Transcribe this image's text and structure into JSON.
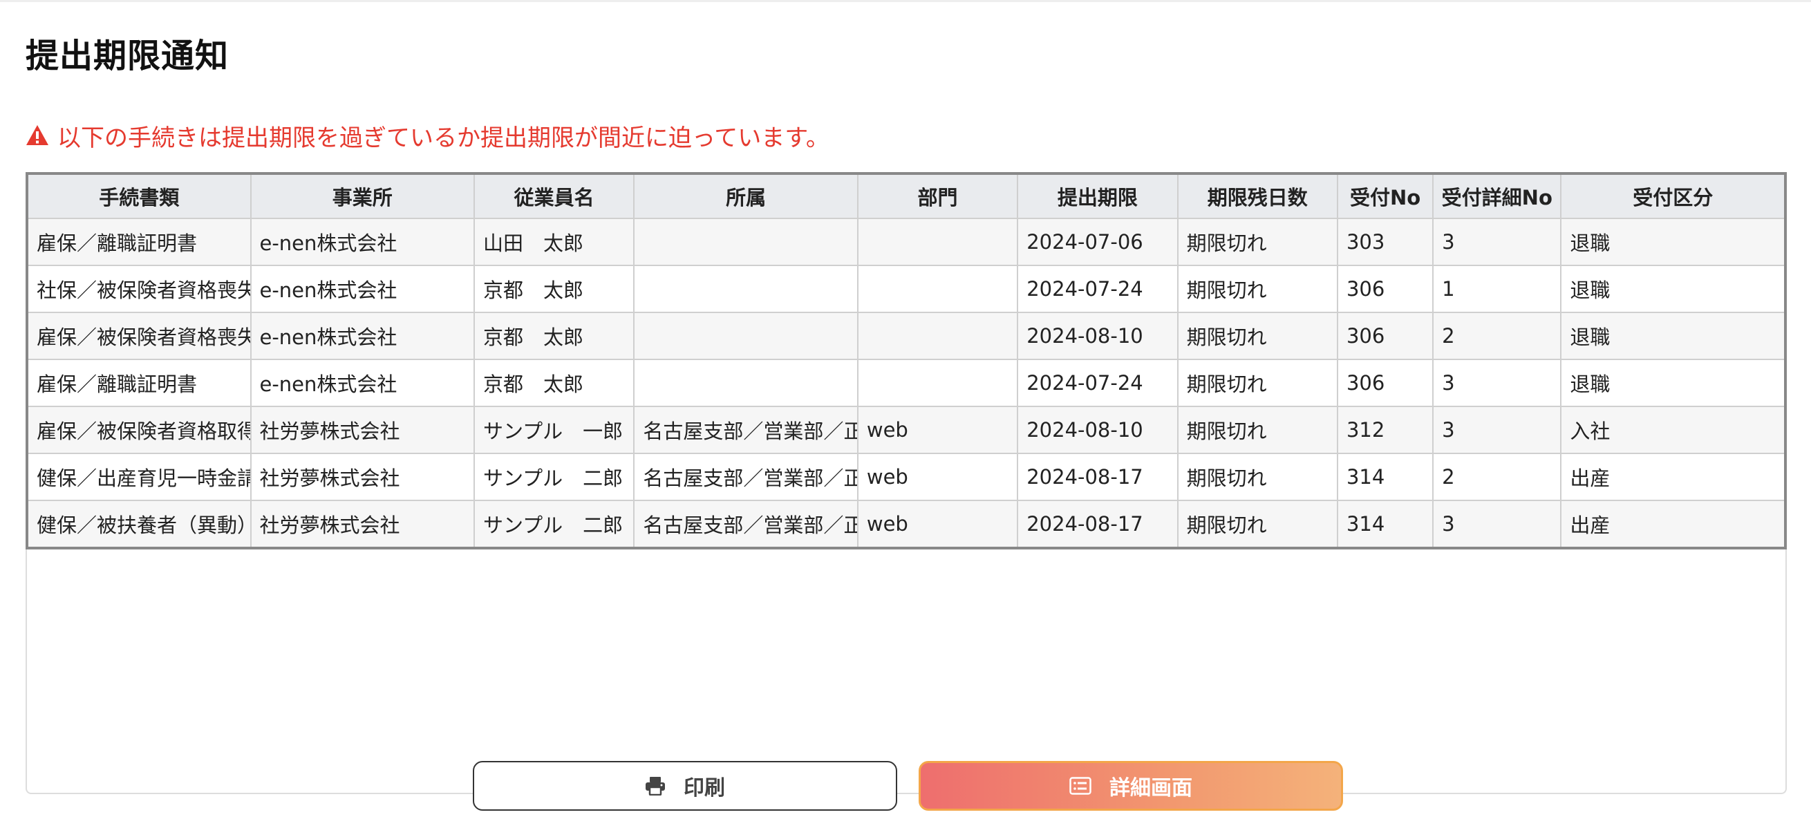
{
  "page": {
    "title": "提出期限通知",
    "warning": "以下の手続きは提出期限を過ぎているか提出期限が間近に迫っています。"
  },
  "table": {
    "headers": [
      "手続書類",
      "事業所",
      "従業員名",
      "所属",
      "部門",
      "提出期限",
      "期限残日数",
      "受付No",
      "受付詳細No",
      "受付区分"
    ],
    "rows": [
      [
        "雇保／離職証明書",
        "e-nen株式会社",
        "山田　太郎",
        "",
        "",
        "2024-07-06",
        "期限切れ",
        "303",
        "3",
        "退職"
      ],
      [
        "社保／被保険者資格喪失",
        "e-nen株式会社",
        "京都　太郎",
        "",
        "",
        "2024-07-24",
        "期限切れ",
        "306",
        "1",
        "退職"
      ],
      [
        "雇保／被保険者資格喪失",
        "e-nen株式会社",
        "京都　太郎",
        "",
        "",
        "2024-08-10",
        "期限切れ",
        "306",
        "2",
        "退職"
      ],
      [
        "雇保／離職証明書",
        "e-nen株式会社",
        "京都　太郎",
        "",
        "",
        "2024-07-24",
        "期限切れ",
        "306",
        "3",
        "退職"
      ],
      [
        "雇保／被保険者資格取得",
        "社労夢株式会社",
        "サンプル　一郎",
        "名古屋支部／営業部／正",
        "web",
        "2024-08-10",
        "期限切れ",
        "312",
        "3",
        "入社"
      ],
      [
        "健保／出産育児一時金請",
        "社労夢株式会社",
        "サンプル　二郎",
        "名古屋支部／営業部／正",
        "web",
        "2024-08-17",
        "期限切れ",
        "314",
        "2",
        "出産"
      ],
      [
        "健保／被扶養者（異動）届",
        "社労夢株式会社",
        "サンプル　二郎",
        "名古屋支部／営業部／正",
        "web",
        "2024-08-17",
        "期限切れ",
        "314",
        "3",
        "出産"
      ]
    ]
  },
  "buttons": {
    "print": {
      "label": "印刷",
      "icon": "printer-icon"
    },
    "detail": {
      "label": "詳細画面",
      "icon": "detail-card-icon"
    }
  },
  "colors": {
    "warning": "#e53a2f",
    "header_bg": "#e9ebee",
    "detail_button_gradient_start": "#ee6e6e",
    "detail_button_gradient_end": "#f4b27a"
  }
}
